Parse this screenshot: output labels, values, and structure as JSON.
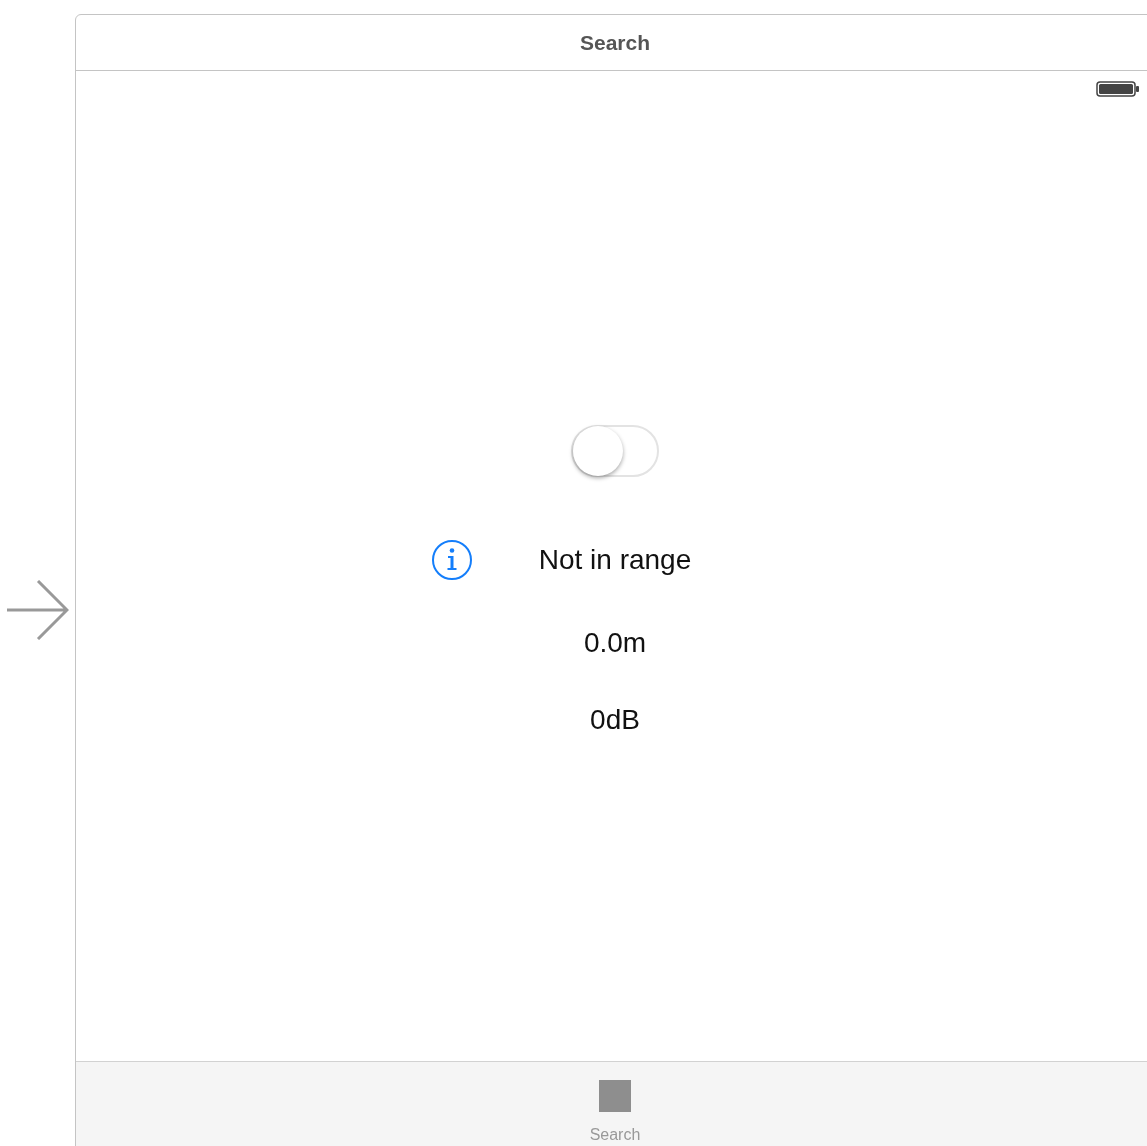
{
  "scene": {
    "title": "Search"
  },
  "range_switch": {
    "on": false
  },
  "status_label": "Not in range",
  "distance": "0.0m",
  "signal": "0dB",
  "tab_bar": {
    "items": [
      {
        "label": "Search",
        "selected": false
      }
    ]
  }
}
